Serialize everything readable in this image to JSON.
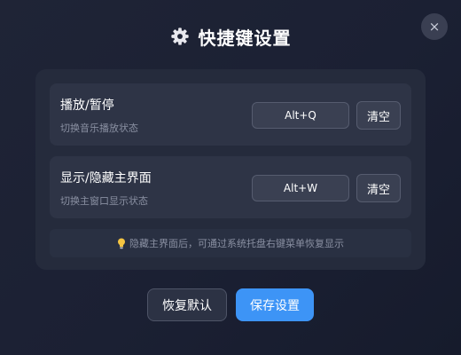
{
  "dialog": {
    "title": "快捷键设置",
    "close_label": "×",
    "title_icon": "gear-icon"
  },
  "shortcuts": [
    {
      "name": "播放/暂停",
      "description": "切换音乐播放状态",
      "key": "Alt+Q",
      "clear_label": "清空"
    },
    {
      "name": "显示/隐藏主界面",
      "description": "切换主窗口显示状态",
      "key": "Alt+W",
      "clear_label": "清空"
    }
  ],
  "tip": {
    "icon": "lightbulb-icon",
    "text": "隐藏主界面后，可通过系统托盘右键菜单恢复显示"
  },
  "footer": {
    "reset_label": "恢复默认",
    "save_label": "保存设置"
  },
  "colors": {
    "accent": "#3d94f6",
    "background": "#1b2033",
    "panel": "#252b3c",
    "row": "#2e3446"
  }
}
